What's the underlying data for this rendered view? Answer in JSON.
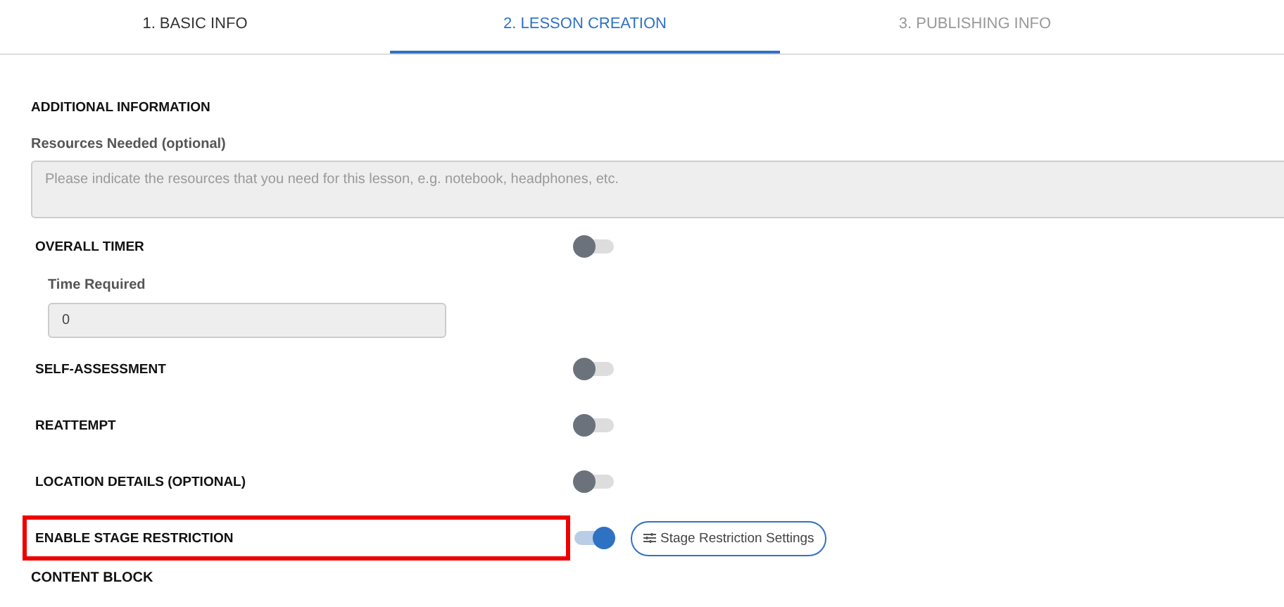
{
  "tabs": [
    {
      "label": "1. BASIC INFO",
      "selected": false,
      "done": true
    },
    {
      "label": "2. LESSON CREATION",
      "selected": true,
      "done": false
    },
    {
      "label": "3. PUBLISHING INFO",
      "selected": false,
      "done": false
    }
  ],
  "section_title": "ADDITIONAL INFORMATION",
  "resources": {
    "label": "Resources Needed (optional)",
    "placeholder": "Please indicate the resources that you need for this lesson, e.g. notebook, headphones, etc."
  },
  "settings": [
    {
      "kind": "toggle",
      "label": "OVERALL TIMER",
      "on": false,
      "highlighted": false
    },
    {
      "kind": "field",
      "label": "Time Required",
      "value": "0"
    },
    {
      "kind": "toggle",
      "label": "SELF-ASSESSMENT",
      "on": false,
      "highlighted": false
    },
    {
      "kind": "toggle",
      "label": "REATTEMPT",
      "on": false,
      "highlighted": false
    },
    {
      "kind": "toggle",
      "label": "LOCATION DETAILS (OPTIONAL)",
      "on": false,
      "highlighted": false
    },
    {
      "kind": "toggle",
      "label": "ENABLE STAGE RESTRICTION",
      "on": true,
      "highlighted": true,
      "button": "Stage Restriction Settings"
    }
  ],
  "next_section_title": "CONTENT BLOCK"
}
